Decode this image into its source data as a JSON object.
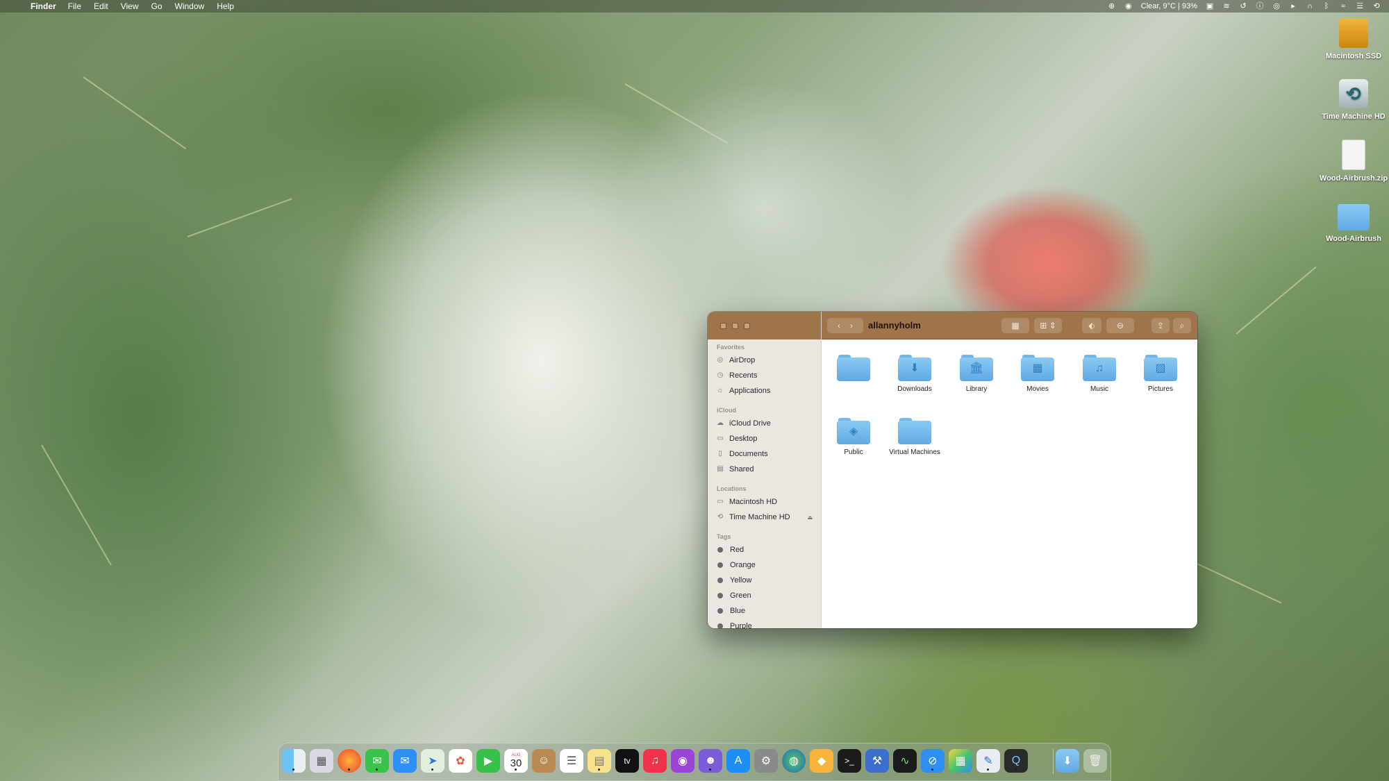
{
  "menubar": {
    "app_name": "Finder",
    "menus": [
      "File",
      "Edit",
      "View",
      "Go",
      "Window",
      "Help"
    ],
    "weather": "Clear, 9°C | 93%"
  },
  "desktop_icons": [
    {
      "label": "Macintosh SSD",
      "icon": "disk-icon"
    },
    {
      "label": "Time Machine HD",
      "icon": "time-machine-icon"
    },
    {
      "label": "Wood-Airbrush.zip",
      "icon": "zip-icon"
    },
    {
      "label": "Wood-Airbrush",
      "icon": "folder-icon"
    }
  ],
  "finder": {
    "title": "allannyholm",
    "sidebar": {
      "favorites_header": "Favorites",
      "favorites": [
        "AirDrop",
        "Recents",
        "Applications"
      ],
      "icloud_header": "iCloud",
      "icloud": [
        "iCloud Drive",
        "Desktop",
        "Documents",
        "Shared"
      ],
      "locations_header": "Locations",
      "locations": [
        "Macintosh HD",
        "Time Machine HD"
      ],
      "tags_header": "Tags",
      "tags": [
        "Red",
        "Orange",
        "Yellow",
        "Green",
        "Blue",
        "Purple"
      ]
    },
    "items": [
      {
        "label": "",
        "glyph": ""
      },
      {
        "label": "Downloads",
        "glyph": "⬇"
      },
      {
        "label": "Library",
        "glyph": "🏛"
      },
      {
        "label": "Movies",
        "glyph": "▦"
      },
      {
        "label": "Music",
        "glyph": "♫"
      },
      {
        "label": "Pictures",
        "glyph": "▨"
      },
      {
        "label": "Public",
        "glyph": "◈"
      },
      {
        "label": "Virtual Machines",
        "glyph": ""
      }
    ]
  },
  "dock": {
    "calendar_month": "AUG",
    "calendar_day": "30",
    "tv_label": "tv"
  }
}
